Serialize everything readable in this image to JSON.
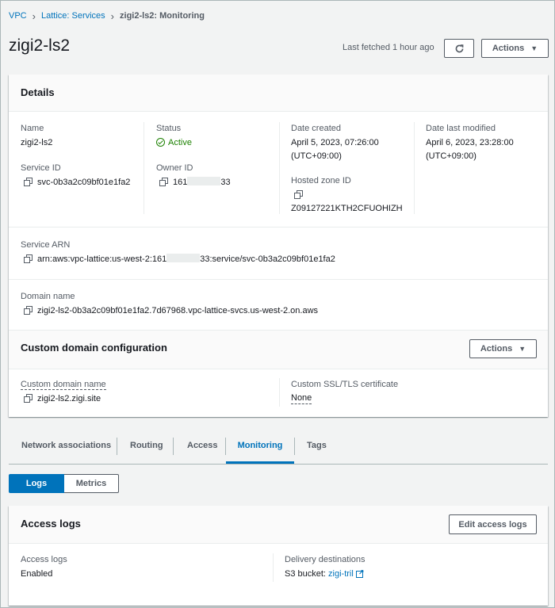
{
  "breadcrumb": {
    "items": [
      "VPC",
      "Lattice: Services"
    ],
    "current": "zigi2-ls2: Monitoring"
  },
  "page": {
    "title": "zigi2-ls2",
    "last_fetched": "Last fetched 1 hour ago",
    "refresh_icon": "refresh-icon",
    "actions_label": "Actions"
  },
  "details": {
    "title": "Details",
    "name_label": "Name",
    "name_value": "zigi2-ls2",
    "service_id_label": "Service ID",
    "service_id_value": "svc-0b3a2c09bf01e1fa2",
    "status_label": "Status",
    "status_value": "Active",
    "owner_id_label": "Owner ID",
    "owner_id_prefix": "161",
    "owner_id_suffix": "33",
    "date_created_label": "Date created",
    "date_created_value": "April 5, 2023, 07:26:00",
    "date_created_tz": "(UTC+09:00)",
    "hosted_zone_label": "Hosted zone ID",
    "hosted_zone_value": "Z09127221KTH2CFUOHIZH",
    "date_modified_label": "Date last modified",
    "date_modified_value": "April 6, 2023, 23:28:00",
    "date_modified_tz": "(UTC+09:00)",
    "arn_label": "Service ARN",
    "arn_prefix": "arn:aws:vpc-lattice:us-west-2:161",
    "arn_suffix": "33:service/svc-0b3a2c09bf01e1fa2",
    "domain_label": "Domain name",
    "domain_value": "zigi2-ls2-0b3a2c09bf01e1fa2.7d67968.vpc-lattice-svcs.us-west-2.on.aws"
  },
  "custom_domain": {
    "title": "Custom domain configuration",
    "actions_label": "Actions",
    "name_label": "Custom domain name",
    "name_value": "zigi2-ls2.zigi.site",
    "cert_label": "Custom SSL/TLS certificate",
    "cert_value": "None"
  },
  "tabs": [
    "Network associations",
    "Routing",
    "Access",
    "Monitoring",
    "Tags"
  ],
  "active_tab": "Monitoring",
  "segments": [
    "Logs",
    "Metrics"
  ],
  "active_segment": "Logs",
  "access_logs": {
    "title": "Access logs",
    "edit_label": "Edit access logs",
    "logs_label": "Access logs",
    "logs_value": "Enabled",
    "dest_label": "Delivery destinations",
    "dest_prefix": "S3 bucket:",
    "dest_link": "zigi-tril"
  },
  "colors": {
    "accent": "#0073bb",
    "success": "#1d8102",
    "background": "#f2f3f3"
  }
}
